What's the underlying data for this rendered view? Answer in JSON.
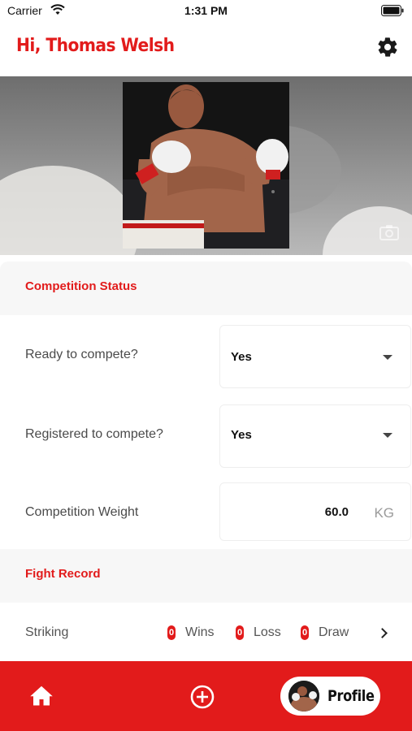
{
  "status_bar": {
    "carrier": "Carrier",
    "time": "1:31 PM"
  },
  "header": {
    "greeting": "Hi, Thomas Welsh"
  },
  "competition": {
    "title": "Competition Status",
    "ready_label": "Ready to compete?",
    "ready_value": "Yes",
    "registered_label": "Registered to compete?",
    "registered_value": "Yes",
    "weight_label": "Competition Weight",
    "weight_value": "60.0",
    "weight_unit": "KG"
  },
  "fight_record": {
    "title": "Fight Record",
    "category": "Striking",
    "wins_count": "0",
    "wins_label": "Wins",
    "loss_count": "0",
    "loss_label": "Loss",
    "draw_count": "0",
    "draw_label": "Draw"
  },
  "tab_bar": {
    "profile_label": "Profile"
  },
  "colors": {
    "accent": "#e21b1b",
    "section_bg": "#f7f7f7"
  }
}
